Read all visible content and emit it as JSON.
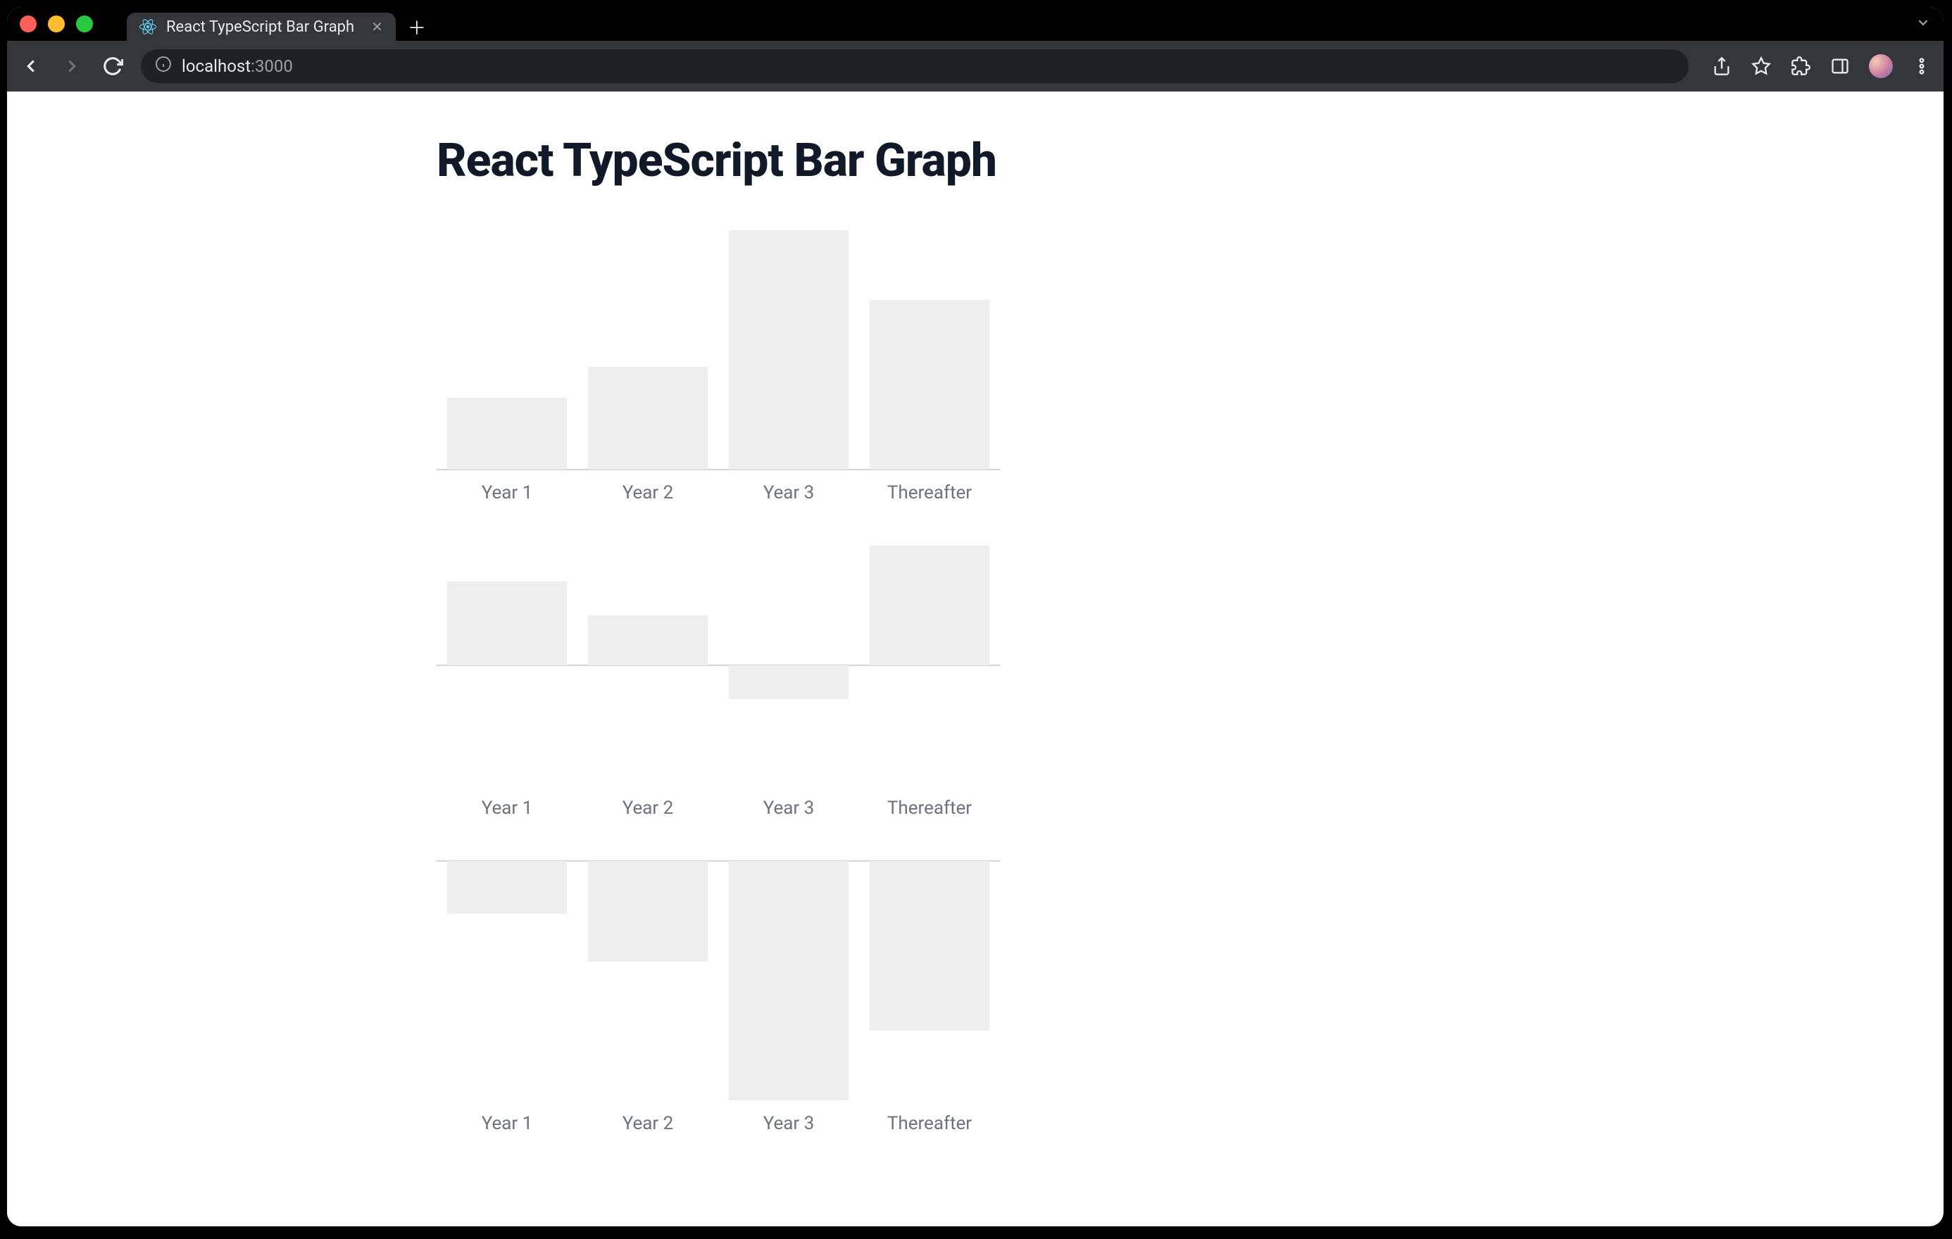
{
  "browser": {
    "tab_title": "React TypeScript Bar Graph",
    "url_host": "localhost",
    "url_port": ":3000"
  },
  "page": {
    "heading": "React TypeScript Bar Graph"
  },
  "chart_data": [
    {
      "type": "bar",
      "categories": [
        "Year 1",
        "Year 2",
        "Year 3",
        "Thereafter"
      ],
      "values": [
        30,
        43,
        100,
        71
      ],
      "ylim": [
        0,
        100
      ]
    },
    {
      "type": "bar",
      "categories": [
        "Year 1",
        "Year 2",
        "Year 3",
        "Thereafter"
      ],
      "values": [
        70,
        42,
        -28,
        100
      ],
      "ylim": [
        -100,
        100
      ]
    },
    {
      "type": "bar",
      "categories": [
        "Year 1",
        "Year 2",
        "Year 3",
        "Thereafter"
      ],
      "values": [
        -22,
        -42,
        -100,
        -71
      ],
      "ylim": [
        -100,
        0
      ]
    }
  ]
}
